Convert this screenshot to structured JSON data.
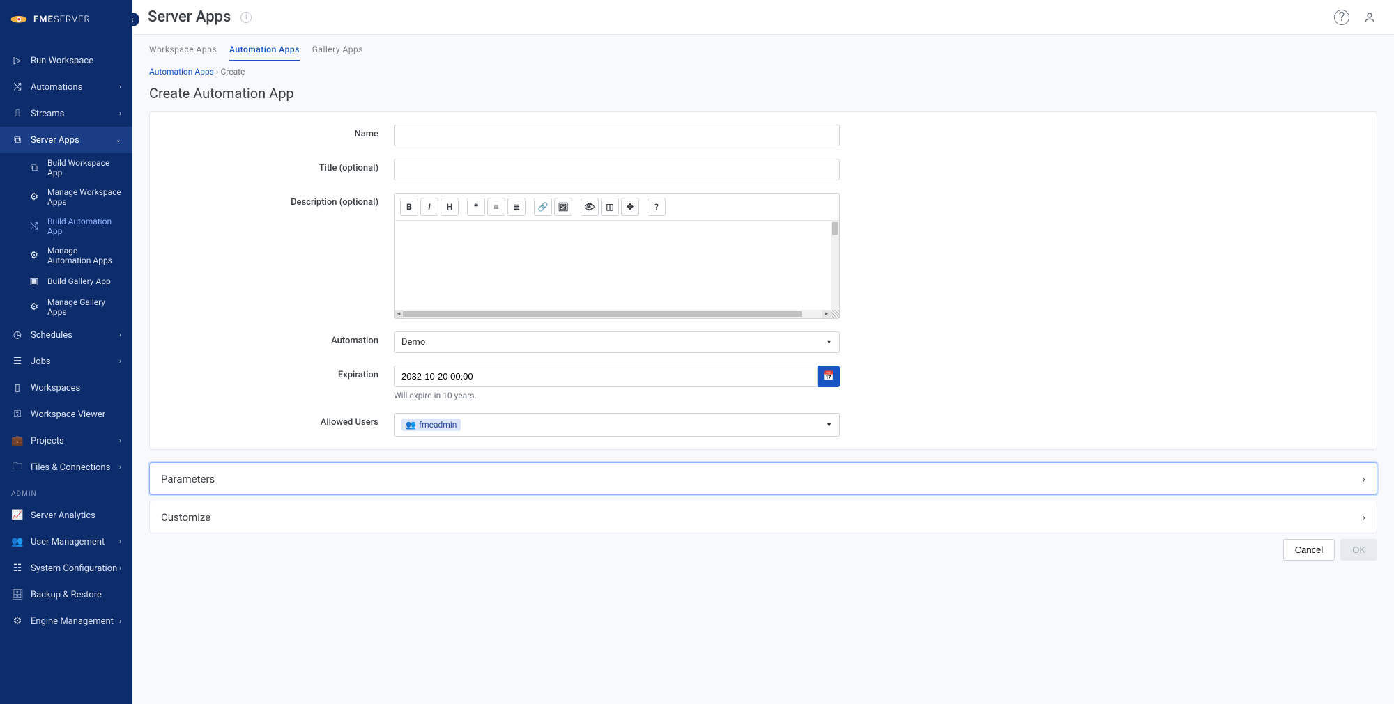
{
  "sidebar": {
    "logo": {
      "strong": "FME",
      "thin": "SERVER"
    },
    "items": [
      {
        "label": "Run Workspace",
        "icon": "play"
      },
      {
        "label": "Automations",
        "icon": "shuffle",
        "chevron": true
      },
      {
        "label": "Streams",
        "icon": "waveform",
        "chevron": true
      },
      {
        "label": "Server Apps",
        "icon": "app",
        "chevron": true,
        "expanded": true,
        "active": true,
        "sub": [
          {
            "label": "Build Workspace App",
            "icon": "app"
          },
          {
            "label": "Manage Workspace Apps",
            "icon": "gear"
          },
          {
            "label": "Build Automation App",
            "icon": "shuffle",
            "selected": true
          },
          {
            "label": "Manage Automation Apps",
            "icon": "gear"
          },
          {
            "label": "Build Gallery App",
            "icon": "gallery"
          },
          {
            "label": "Manage Gallery Apps",
            "icon": "gear"
          }
        ]
      },
      {
        "label": "Schedules",
        "icon": "clock",
        "chevron": true
      },
      {
        "label": "Jobs",
        "icon": "list",
        "chevron": true
      },
      {
        "label": "Workspaces",
        "icon": "doc"
      },
      {
        "label": "Workspace Viewer",
        "icon": "key"
      },
      {
        "label": "Projects",
        "icon": "briefcase",
        "chevron": true
      },
      {
        "label": "Files & Connections",
        "icon": "folder",
        "chevron": true
      }
    ],
    "admin_label": "ADMIN",
    "admin_items": [
      {
        "label": "Server Analytics",
        "icon": "chart"
      },
      {
        "label": "User Management",
        "icon": "users",
        "chevron": true
      },
      {
        "label": "System Configuration",
        "icon": "sliders",
        "chevron": true
      },
      {
        "label": "Backup & Restore",
        "icon": "backup"
      },
      {
        "label": "Engine Management",
        "icon": "engine",
        "chevron": true
      }
    ]
  },
  "topbar": {
    "title": "Server Apps"
  },
  "tabs": [
    {
      "label": "Workspace Apps"
    },
    {
      "label": "Automation Apps",
      "active": true
    },
    {
      "label": "Gallery Apps"
    }
  ],
  "breadcrumb": {
    "root": "Automation Apps",
    "sep": "›",
    "leaf": "Create"
  },
  "page_heading": "Create Automation App",
  "form": {
    "name_label": "Name",
    "name_value": "",
    "title_label": "Title (optional)",
    "title_value": "",
    "desc_label": "Description (optional)",
    "desc_value": "",
    "automation_label": "Automation",
    "automation_value": "Demo",
    "expiration_label": "Expiration",
    "expiration_value": "2032-10-20 00:00",
    "expiration_helper": "Will expire in 10 years.",
    "allowed_label": "Allowed Users",
    "allowed_chip": "fmeadmin"
  },
  "accordions": {
    "parameters": "Parameters",
    "customize": "Customize"
  },
  "buttons": {
    "cancel": "Cancel",
    "ok": "OK"
  }
}
